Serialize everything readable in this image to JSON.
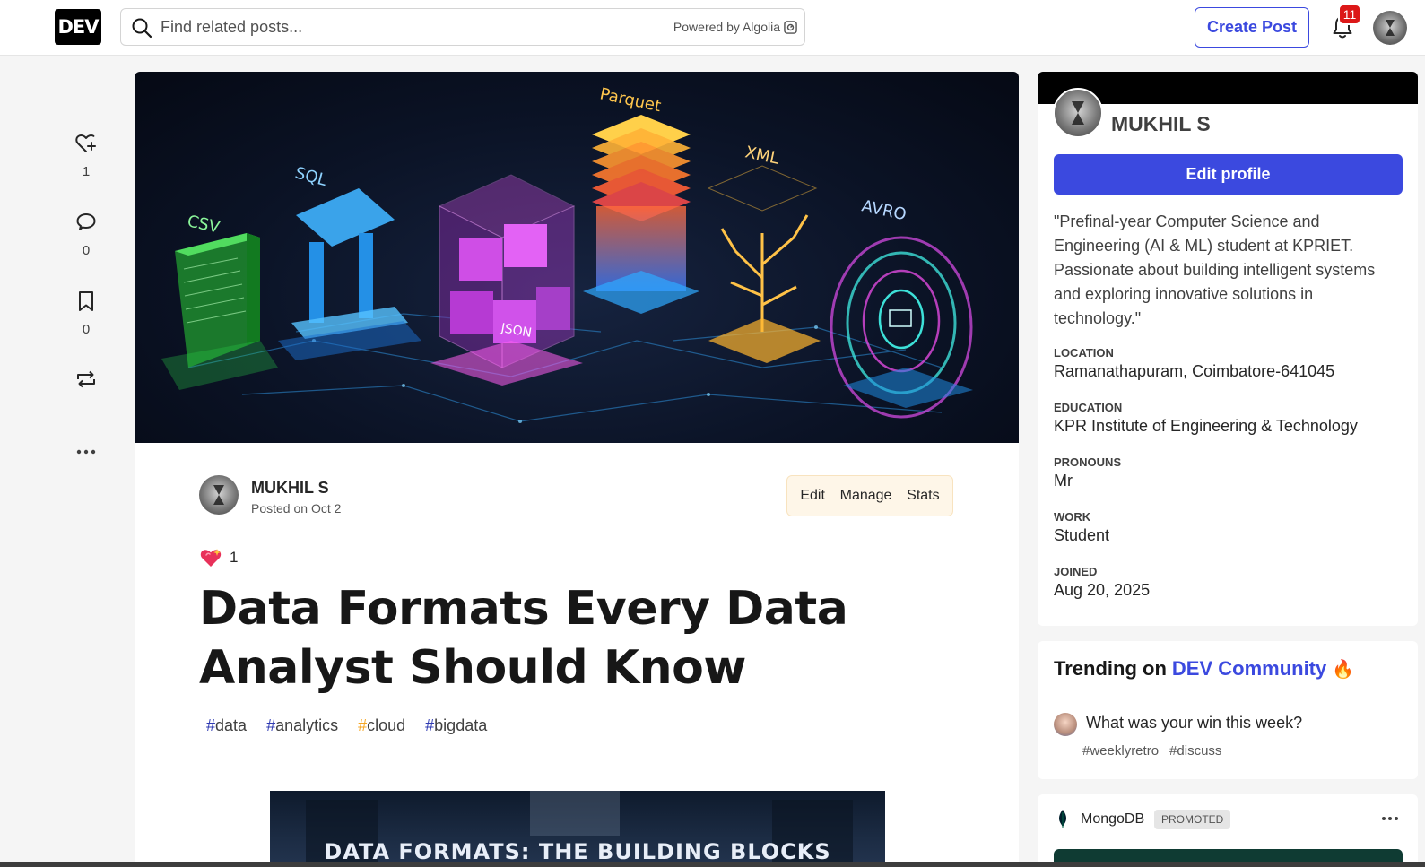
{
  "header": {
    "logo": "DEV",
    "search_placeholder": "Find related posts...",
    "powered_by": "Powered by Algolia",
    "create_post": "Create Post",
    "notification_count": "11"
  },
  "rail": [
    {
      "name": "reaction",
      "icon": "heart-plus-icon",
      "count": "1"
    },
    {
      "name": "comment",
      "icon": "comment-icon",
      "count": "0"
    },
    {
      "name": "bookmark",
      "icon": "bookmark-icon",
      "count": "0"
    },
    {
      "name": "boost",
      "icon": "repost-icon",
      "count": ""
    },
    {
      "name": "more",
      "icon": "more-icon",
      "count": ""
    }
  ],
  "article": {
    "cover_labels": [
      "CSV",
      "SQL",
      "JSON",
      "Parquet",
      "XML",
      "AVRO"
    ],
    "author": "MUKHIL S",
    "posted": "Posted on Oct 2",
    "actions": [
      "Edit",
      "Manage",
      "Stats"
    ],
    "reaction_count": "1",
    "title": "Data Formats Every Data Analyst Should Know",
    "tags": [
      {
        "hash": "#",
        "label": "data",
        "color": "#2f3ab2"
      },
      {
        "hash": "#",
        "label": "analytics",
        "color": "#2f3ab2"
      },
      {
        "hash": "#",
        "label": "cloud",
        "color": "#f5a623"
      },
      {
        "hash": "#",
        "label": "bigdata",
        "color": "#2f3ab2"
      }
    ],
    "inner_image_text": "DATA FORMATS: THE BUILDING BLOCKS"
  },
  "profile": {
    "name": "MUKHIL S",
    "edit_label": "Edit profile",
    "bio": "\"Prefinal-year Computer Science and Engineering (AI & ML) student at KPRIET. Passionate about building intelligent systems and exploring innovative solutions in technology.\"",
    "details": [
      {
        "key": "LOCATION",
        "value": "Ramanathapuram, Coimbatore-641045"
      },
      {
        "key": "EDUCATION",
        "value": "KPR Institute of Engineering & Technology"
      },
      {
        "key": "PRONOUNS",
        "value": "Mr"
      },
      {
        "key": "WORK",
        "value": "Student"
      },
      {
        "key": "JOINED",
        "value": "Aug 20, 2025"
      }
    ]
  },
  "trending": {
    "prefix": "Trending on",
    "community": "DEV Community",
    "emoji": "🔥",
    "item": "What was your win this week?",
    "tags": [
      "#weeklyretro",
      "#discuss"
    ]
  },
  "promo": {
    "name": "MongoDB",
    "badge": "PROMOTED"
  }
}
